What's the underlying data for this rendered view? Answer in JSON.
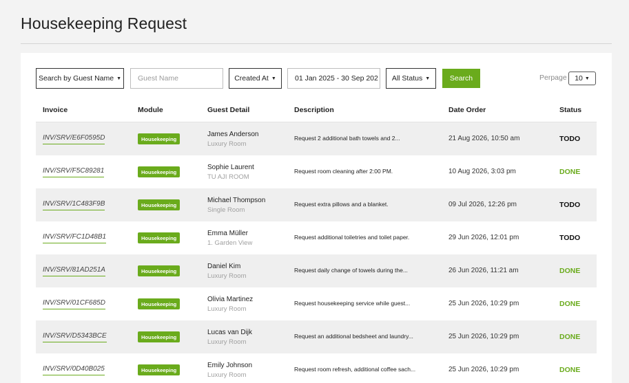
{
  "page": {
    "title": "Housekeeping Request"
  },
  "filters": {
    "search_by": "Search by Guest Name",
    "guest_name_placeholder": "Guest Name",
    "sort_by": "Created At",
    "date_range": "01 Jan 2025 - 30 Sep 202",
    "status": "All Status",
    "search_label": "Search",
    "perpage_label": "Perpage",
    "perpage_value": "10"
  },
  "colors": {
    "accent": "#6aab1c",
    "row_shade": "#efefef"
  },
  "table": {
    "headers": {
      "invoice": "Invoice",
      "module": "Module",
      "guest": "Guest Detail",
      "description": "Description",
      "date": "Date Order",
      "status": "Status"
    },
    "rows": [
      {
        "invoice": "INV/SRV/E6F0595D",
        "module": "Housekeeping",
        "guest_name": "James Anderson",
        "room": "Luxury Room",
        "description": "Request 2 additional bath towels and 2...",
        "date": "21 Aug 2026, 10:50 am",
        "status": "TODO"
      },
      {
        "invoice": "INV/SRV/F5C89281",
        "module": "Housekeeping",
        "guest_name": "Sophie Laurent",
        "room": "TU AJI ROOM",
        "description": "Request room cleaning after 2:00 PM.",
        "date": "10 Aug 2026, 3:03 pm",
        "status": "DONE"
      },
      {
        "invoice": "INV/SRV/1C483F9B",
        "module": "Housekeeping",
        "guest_name": "Michael Thompson",
        "room": "Single Room",
        "description": "Request extra pillows and a blanket.",
        "date": "09 Jul 2026, 12:26 pm",
        "status": "TODO"
      },
      {
        "invoice": "INV/SRV/FC1D48B1",
        "module": "Housekeeping",
        "guest_name": "Emma Müller",
        "room": "1. Garden View",
        "description": "Request additional toiletries and toilet paper.",
        "date": "29 Jun 2026, 12:01 pm",
        "status": "TODO"
      },
      {
        "invoice": "INV/SRV/81AD251A",
        "module": "Housekeeping",
        "guest_name": "Daniel Kim",
        "room": "Luxury Room",
        "description": "Request daily change of towels during the...",
        "date": "26 Jun 2026, 11:21 am",
        "status": "DONE"
      },
      {
        "invoice": "INV/SRV/01CF685D",
        "module": "Housekeeping",
        "guest_name": "Olivia Martinez",
        "room": "Luxury Room",
        "description": "Request housekeeping service while guest...",
        "date": "25 Jun 2026, 10:29 pm",
        "status": "DONE"
      },
      {
        "invoice": "INV/SRV/D5343BCE",
        "module": "Housekeeping",
        "guest_name": "Lucas van Dijk",
        "room": "Luxury Room",
        "description": "Request an additional bedsheet and laundry...",
        "date": "25 Jun 2026, 10:29 pm",
        "status": "DONE"
      },
      {
        "invoice": "INV/SRV/0D40B025",
        "module": "Housekeeping",
        "guest_name": "Emily Johnson",
        "room": "Luxury Room",
        "description": "Request room refresh, additional coffee sach...",
        "date": "25 Jun 2026, 10:29 pm",
        "status": "DONE"
      }
    ]
  }
}
